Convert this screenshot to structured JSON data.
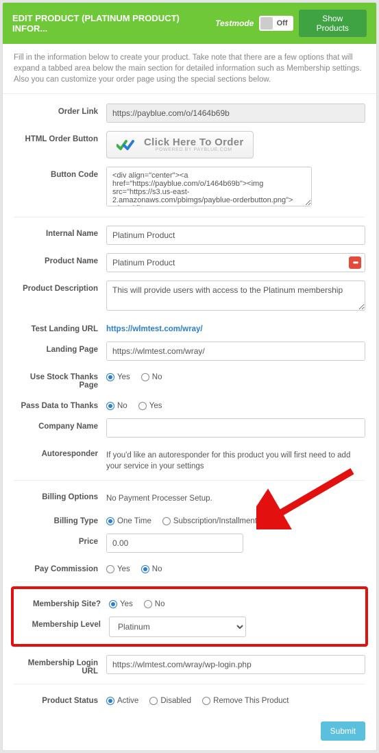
{
  "header": {
    "title": "EDIT PRODUCT (PLATINUM PRODUCT) INFOR...",
    "testmode_label": "Testmode",
    "toggle_text": "Off",
    "show_products": "Show Products"
  },
  "intro": "Fill in the information below to create your product. Take note that there are a few options that will expand a tabbed area below the main section for detailed information such as Membership settings. Also you can customize your order page using the special sections below.",
  "labels": {
    "order_link": "Order Link",
    "html_order_button": "HTML Order Button",
    "button_code": "Button Code",
    "internal_name": "Internal Name",
    "product_name": "Product Name",
    "product_description": "Product Description",
    "test_landing_url": "Test Landing URL",
    "landing_page": "Landing Page",
    "use_stock_thanks": "Use Stock Thanks Page",
    "pass_data_thanks": "Pass Data to Thanks",
    "company_name": "Company Name",
    "autoresponder": "Autoresponder",
    "billing_options": "Billing Options",
    "billing_type": "Billing Type",
    "price": "Price",
    "pay_commission": "Pay Commission",
    "membership_site": "Membership Site?",
    "membership_level": "Membership Level",
    "membership_login_url": "Membership Login URL",
    "product_status": "Product Status"
  },
  "values": {
    "order_link": "https://payblue.com/o/1464b69b",
    "button_code": "<div align=\"center\"><a href=\"https://payblue.com/o/1464b69b\"><img src=\"https://s3.us-east-2.amazonaws.com/pbimgs/payblue-orderbutton.png\"></a></div>",
    "internal_name": "Platinum Product",
    "product_name": "Platinum Product",
    "product_description": "This will provide users with access to the Platinum membership",
    "test_landing_url": "https://wlmtest.com/wray/",
    "landing_page": "https://wlmtest.com/wray/",
    "company_name": "",
    "autoresponder_text": "If you'd like an autoresponder for this product you will first need to add your service in your settings",
    "billing_options_text": "No Payment Processer Setup.",
    "price": "0.00",
    "membership_level": "Platinum",
    "membership_login_url": "https://wlmtest.com/wray/wp-login.php"
  },
  "order_button": {
    "main": "Click Here To Order",
    "sub": "POWERED BY PAYBLUE.COM"
  },
  "options": {
    "yes": "Yes",
    "no": "No",
    "one_time": "One Time",
    "sub": "Subscription/Installments/Trials",
    "active": "Active",
    "disabled": "Disabled",
    "remove": "Remove This Product"
  },
  "submit": "Submit"
}
